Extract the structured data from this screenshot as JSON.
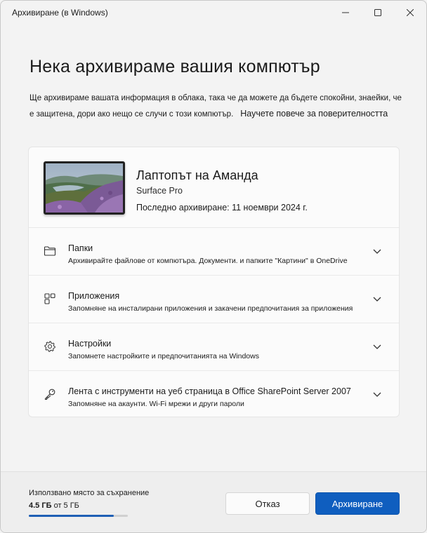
{
  "window": {
    "title": "Архивиране (в Windows)"
  },
  "main": {
    "heading": "Нека архивираме вашия компютър",
    "description": "Ще архивираме вашата информация в облака, така че да можете да бъдете спокойни, знаейки, че е защитена, дори ако нещо се случи с този компютър.",
    "privacy_link": "Научете повече за поверителността"
  },
  "device": {
    "name": "Лаптопът на Аманда",
    "model": "Surface Pro",
    "last_backup": "Последно архивиране: 11 ноември 2024 г."
  },
  "sections": [
    {
      "icon": "folder-icon",
      "title": "Папки",
      "subtitle": "Архивирайте файлове от компютъра. Документи. и папките \"Картини\" в OneDrive"
    },
    {
      "icon": "apps-icon",
      "title": "Приложения",
      "subtitle": "Запомняне на инсталирани приложения и закачени предпочитания за приложения"
    },
    {
      "icon": "gear-icon",
      "title": "Настройки",
      "subtitle": "Запомнете настройките и предпочитанията на Windows"
    },
    {
      "icon": "key-icon",
      "title": "Лента с инструменти на уеб страница в Office SharePoint Server 2007",
      "subtitle": "Запомняне на акаунти. Wi-Fi мрежи и други пароли"
    }
  ],
  "footer": {
    "storage_label": "Използвано място за съхранение",
    "storage_used": "4.5 ГБ",
    "storage_total": "от 5 ГБ",
    "storage_fraction": 0.86,
    "cancel_label": "Отказ",
    "backup_label": "Архивиране"
  },
  "colors": {
    "accent": "#0f5ebf",
    "progress": "#1f5fb5"
  }
}
